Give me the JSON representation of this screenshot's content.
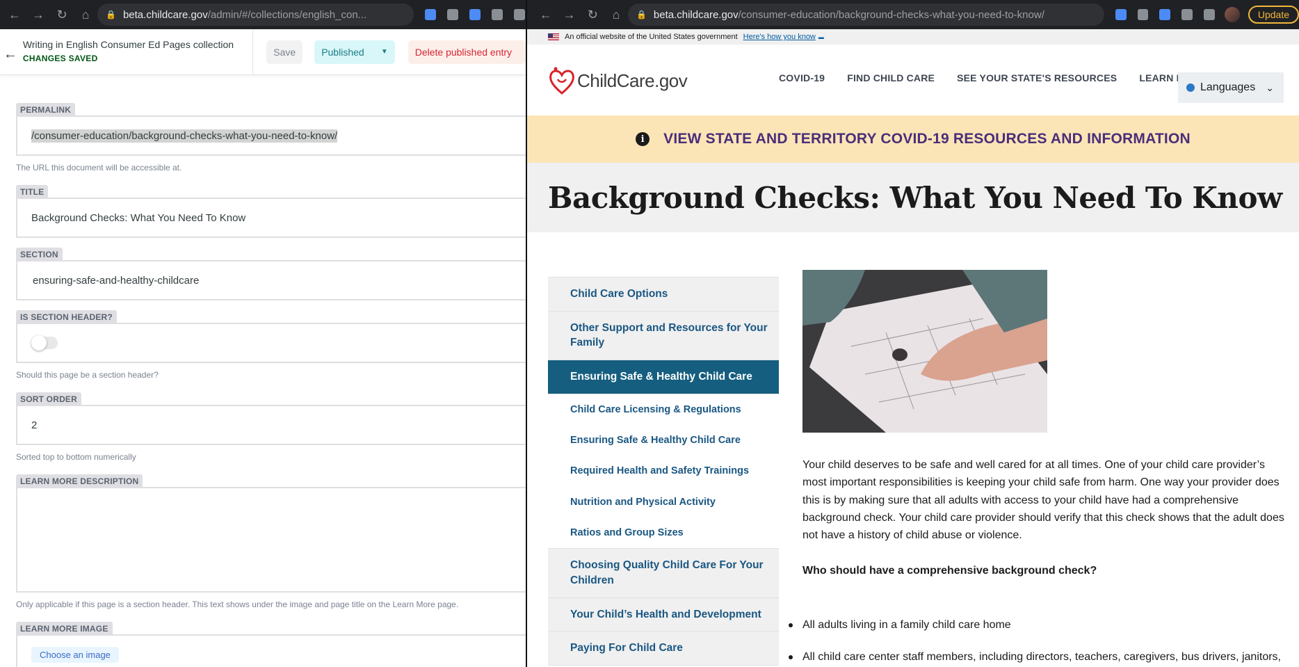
{
  "left_window": {
    "browser": {
      "host": "beta.childcare.gov",
      "path": "/admin/#/collections/english_con..."
    },
    "cms": {
      "collection_title": "Writing in English Consumer Ed Pages collection",
      "save_status": "CHANGES SAVED",
      "save_label": "Save",
      "published_label": "Published",
      "delete_label": "Delete published entry"
    },
    "fields": {
      "permalink": {
        "label": "PERMALINK",
        "value": "/consumer-education/background-checks-what-you-need-to-know/",
        "hint": "The URL this document will be accessible at."
      },
      "title": {
        "label": "TITLE",
        "value": "Background Checks: What You Need To Know"
      },
      "section": {
        "label": "SECTION",
        "value": "ensuring-safe-and-healthy-childcare"
      },
      "is_section_header": {
        "label": "IS SECTION HEADER?",
        "checked": false,
        "hint": "Should this page be a section header?"
      },
      "sort_order": {
        "label": "SORT ORDER",
        "value": "2",
        "hint": "Sorted top to bottom numerically"
      },
      "learn_more_description": {
        "label": "LEARN MORE DESCRIPTION",
        "value": "",
        "hint": "Only applicable if this page is a section header. This text shows under the image and page title on the Learn More page."
      },
      "learn_more_image": {
        "label": "LEARN MORE IMAGE",
        "button": "Choose an image"
      }
    }
  },
  "right_window": {
    "browser": {
      "host": "beta.childcare.gov",
      "path": "/consumer-education/background-checks-what-you-need-to-know/",
      "update_label": "Update"
    },
    "gov_banner": {
      "text": "An official website of the United States government",
      "link": "Here's how you know"
    },
    "site": {
      "logo_text": "ChildCare.gov",
      "nav": [
        "COVID-19",
        "FIND CHILD CARE",
        "SEE YOUR STATE'S RESOURCES",
        "LEARN MORE"
      ],
      "languages_label": "Languages"
    },
    "covid_banner": "VIEW STATE AND TERRITORY COVID-19 RESOURCES AND INFORMATION",
    "page_title": "Background Checks: What You Need To Know",
    "side_nav": [
      {
        "label": "Child Care Options",
        "type": "top"
      },
      {
        "label": "Other Support and Resources for Your Family",
        "type": "top"
      },
      {
        "label": "Ensuring Safe & Healthy Child Care",
        "type": "active"
      },
      {
        "label": "Child Care Licensing & Regulations",
        "type": "sub"
      },
      {
        "label": "Ensuring Safe & Healthy Child Care",
        "type": "sub"
      },
      {
        "label": "Required Health and Safety Trainings",
        "type": "sub"
      },
      {
        "label": "Nutrition and Physical Activity",
        "type": "sub"
      },
      {
        "label": "Ratios and Group Sizes",
        "type": "sub"
      },
      {
        "label": "Choosing Quality Child Care For Your Children",
        "type": "top"
      },
      {
        "label": "Your Child’s Health and Development",
        "type": "top"
      },
      {
        "label": "Paying For Child Care",
        "type": "top"
      }
    ],
    "article": {
      "paragraph": "Your child deserves to be safe and well cared for at all times. One of your child care provider’s most important responsibilities is keeping your child safe from harm. One way your provider does this is by making sure that all adults with access to your child have had a comprehensive background check. Your child care provider should verify that this check shows that the adult does not have a history of child abuse or violence.",
      "question": "Who should have a comprehensive background check?",
      "bullets": [
        "All adults living in a family child care home",
        "All child care center staff members, including directors, teachers, caregivers, bus drivers, janitors,"
      ]
    },
    "colors": {
      "active_nav": "#155e7f",
      "nav_link": "#1a5782",
      "covid_banner_bg": "#fbe5b6",
      "covid_text": "#4a2e7a"
    }
  }
}
